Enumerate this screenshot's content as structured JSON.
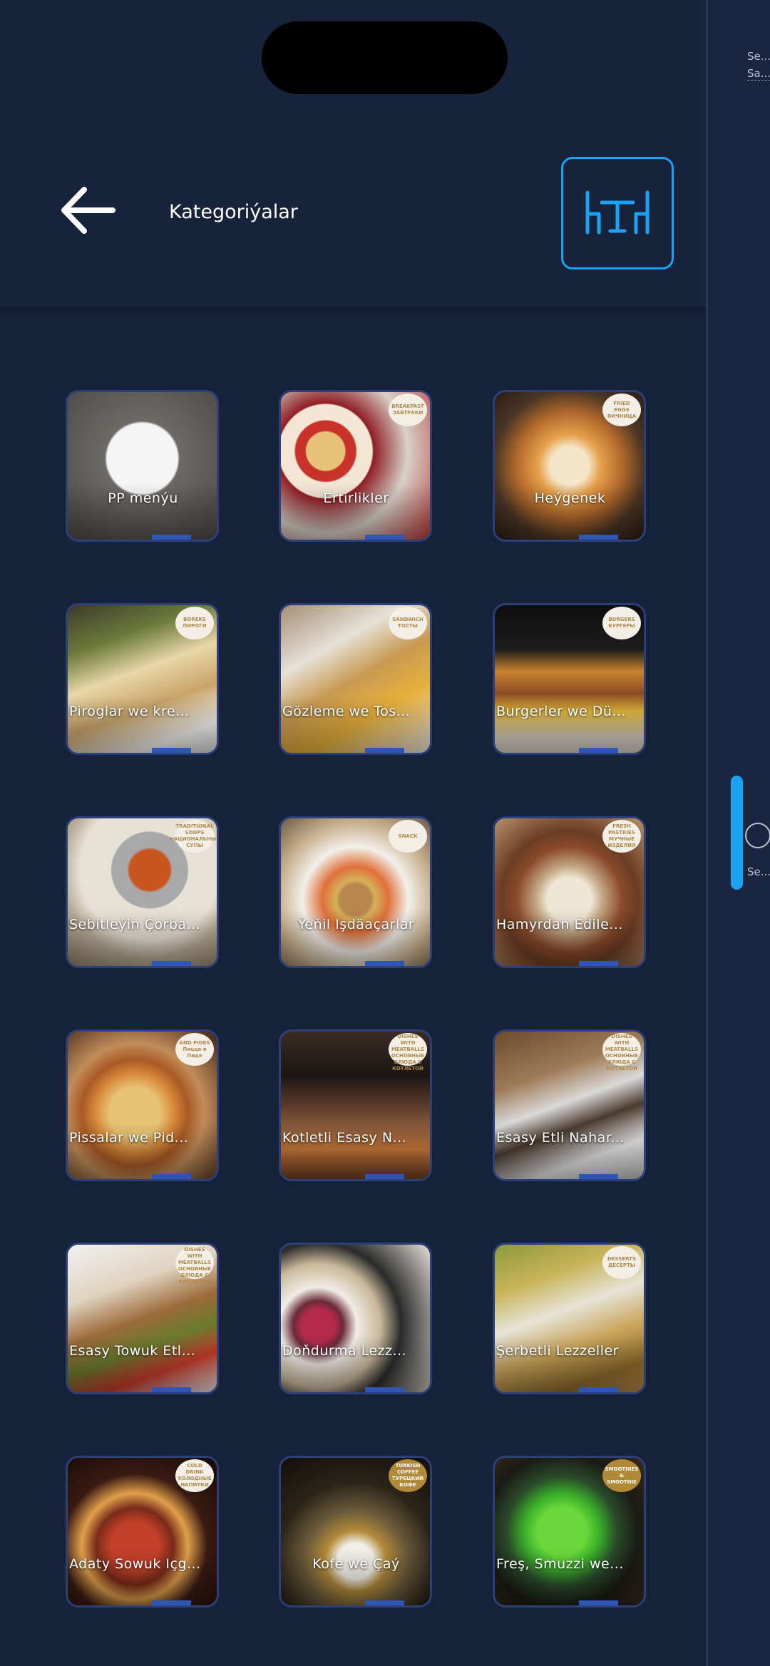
{
  "header": {
    "title": "Kategoriýalar",
    "back_icon": "arrow-left-icon",
    "table_icon": "table-chairs-icon",
    "accent": "#1aa3f2"
  },
  "side_panel": {
    "line1": "Se...",
    "line2": "Sa...",
    "line3": "Se..."
  },
  "colors": {
    "background": "#16223a",
    "card_border": "#2b3f78",
    "tab": "#2f56b5"
  },
  "categories": [
    {
      "label": "PP menýu",
      "badge": ""
    },
    {
      "label": "Ertirlikler",
      "badge": "BREAKFAST ЗАВТРАКИ"
    },
    {
      "label": "Heýgenek",
      "badge": "FRIED EGGS ЯИЧНИЦА"
    },
    {
      "label": "Piroglar we kre...",
      "badge": "BOREKS ПИРОГИ"
    },
    {
      "label": "Gözleme we Tos...",
      "badge": "SANDWICH ТОСТЫ"
    },
    {
      "label": "Burgerler we Dü...",
      "badge": "BURGERS БУРГЕРЫ"
    },
    {
      "label": "Sebitleýin Çorba...",
      "badge": "TRADITIONAL SOUPS НАЦИОНАЛЬНЫЕ СУПЫ"
    },
    {
      "label": "Ýeňil Işdäaçarlar",
      "badge": "SNACK"
    },
    {
      "label": "Hamyrdan Edile...",
      "badge": "FRESH PASTRIES МУЧНЫЕ ИЗДЕЛИЯ"
    },
    {
      "label": "Pissalar we Pid...",
      "badge": "AND PIDES Пицца и Пиде"
    },
    {
      "label": "Kotletli Esasy N...",
      "badge": "MAIN DISHES WITH MEATBALLS ОСНОВНЫЕ БЛЮДА С КОТЛЕТОЙ"
    },
    {
      "label": "Esasy Etli Nahar...",
      "badge": "MAIN DISHES WITH MEATBALLS ОСНОВНЫЕ БЛЮДА С КОТЛЕТОЙ"
    },
    {
      "label": "Esasy Towuk Etl...",
      "badge": "MAIN DISHES WITH MEATBALLS ОСНОВНЫЕ БЛЮДА С КОТЛЕТОЙ"
    },
    {
      "label": "Doňdurma Lezz...",
      "badge": ""
    },
    {
      "label": "Şerbetli Lezzeller",
      "badge": "DESSERTS ДЕСЕРТЫ"
    },
    {
      "label": "Adaty Sowuk Içg...",
      "badge": "COLD DRINK ХОЛОДНЫЕ НАПИТКИ"
    },
    {
      "label": "Kofe we Çaý",
      "badge": "TURKISH COFFEE ТУРЕЦКИЙ КОФЕ"
    },
    {
      "label": "Freş, Smuzzi we...",
      "badge": "SMOOTHIES & SMOOTHIE"
    }
  ]
}
